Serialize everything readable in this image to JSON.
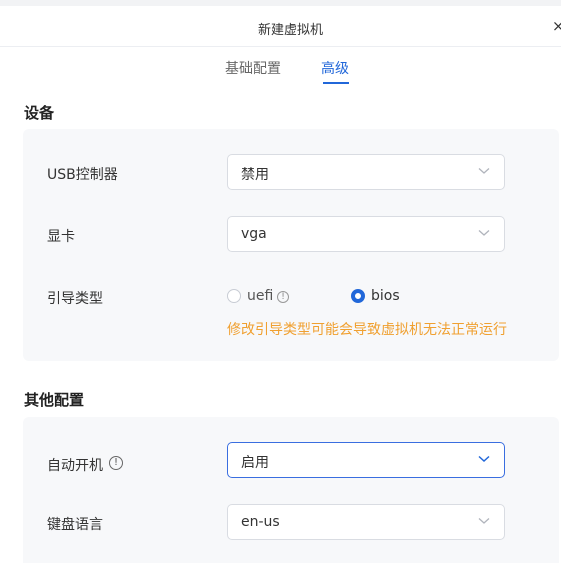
{
  "dialog": {
    "title": "新建虚拟机",
    "close_glyph": "×"
  },
  "tabs": [
    {
      "label": "基础配置",
      "active": false
    },
    {
      "label": "高级",
      "active": true
    }
  ],
  "devices": {
    "title": "设备",
    "usb_controller": {
      "label": "USB控制器",
      "value": "禁用"
    },
    "graphics_card": {
      "label": "显卡",
      "value": "vga"
    },
    "boot_type": {
      "label": "引导类型",
      "options": [
        {
          "label": "uefi",
          "selected": false,
          "has_info": true
        },
        {
          "label": "bios",
          "selected": true
        }
      ],
      "warning": "修改引导类型可能会导致虚拟机无法正常运行"
    }
  },
  "other": {
    "title": "其他配置",
    "autostart": {
      "label": "自动开机",
      "value": "启用",
      "info_glyph": "!"
    },
    "keyboard_language": {
      "label": "键盘语言",
      "value": "en-us"
    }
  },
  "colors": {
    "accent": "#2167d9",
    "warning": "#f0a030",
    "panel_bg": "#f7f8fa",
    "border": "#d9dce2"
  }
}
